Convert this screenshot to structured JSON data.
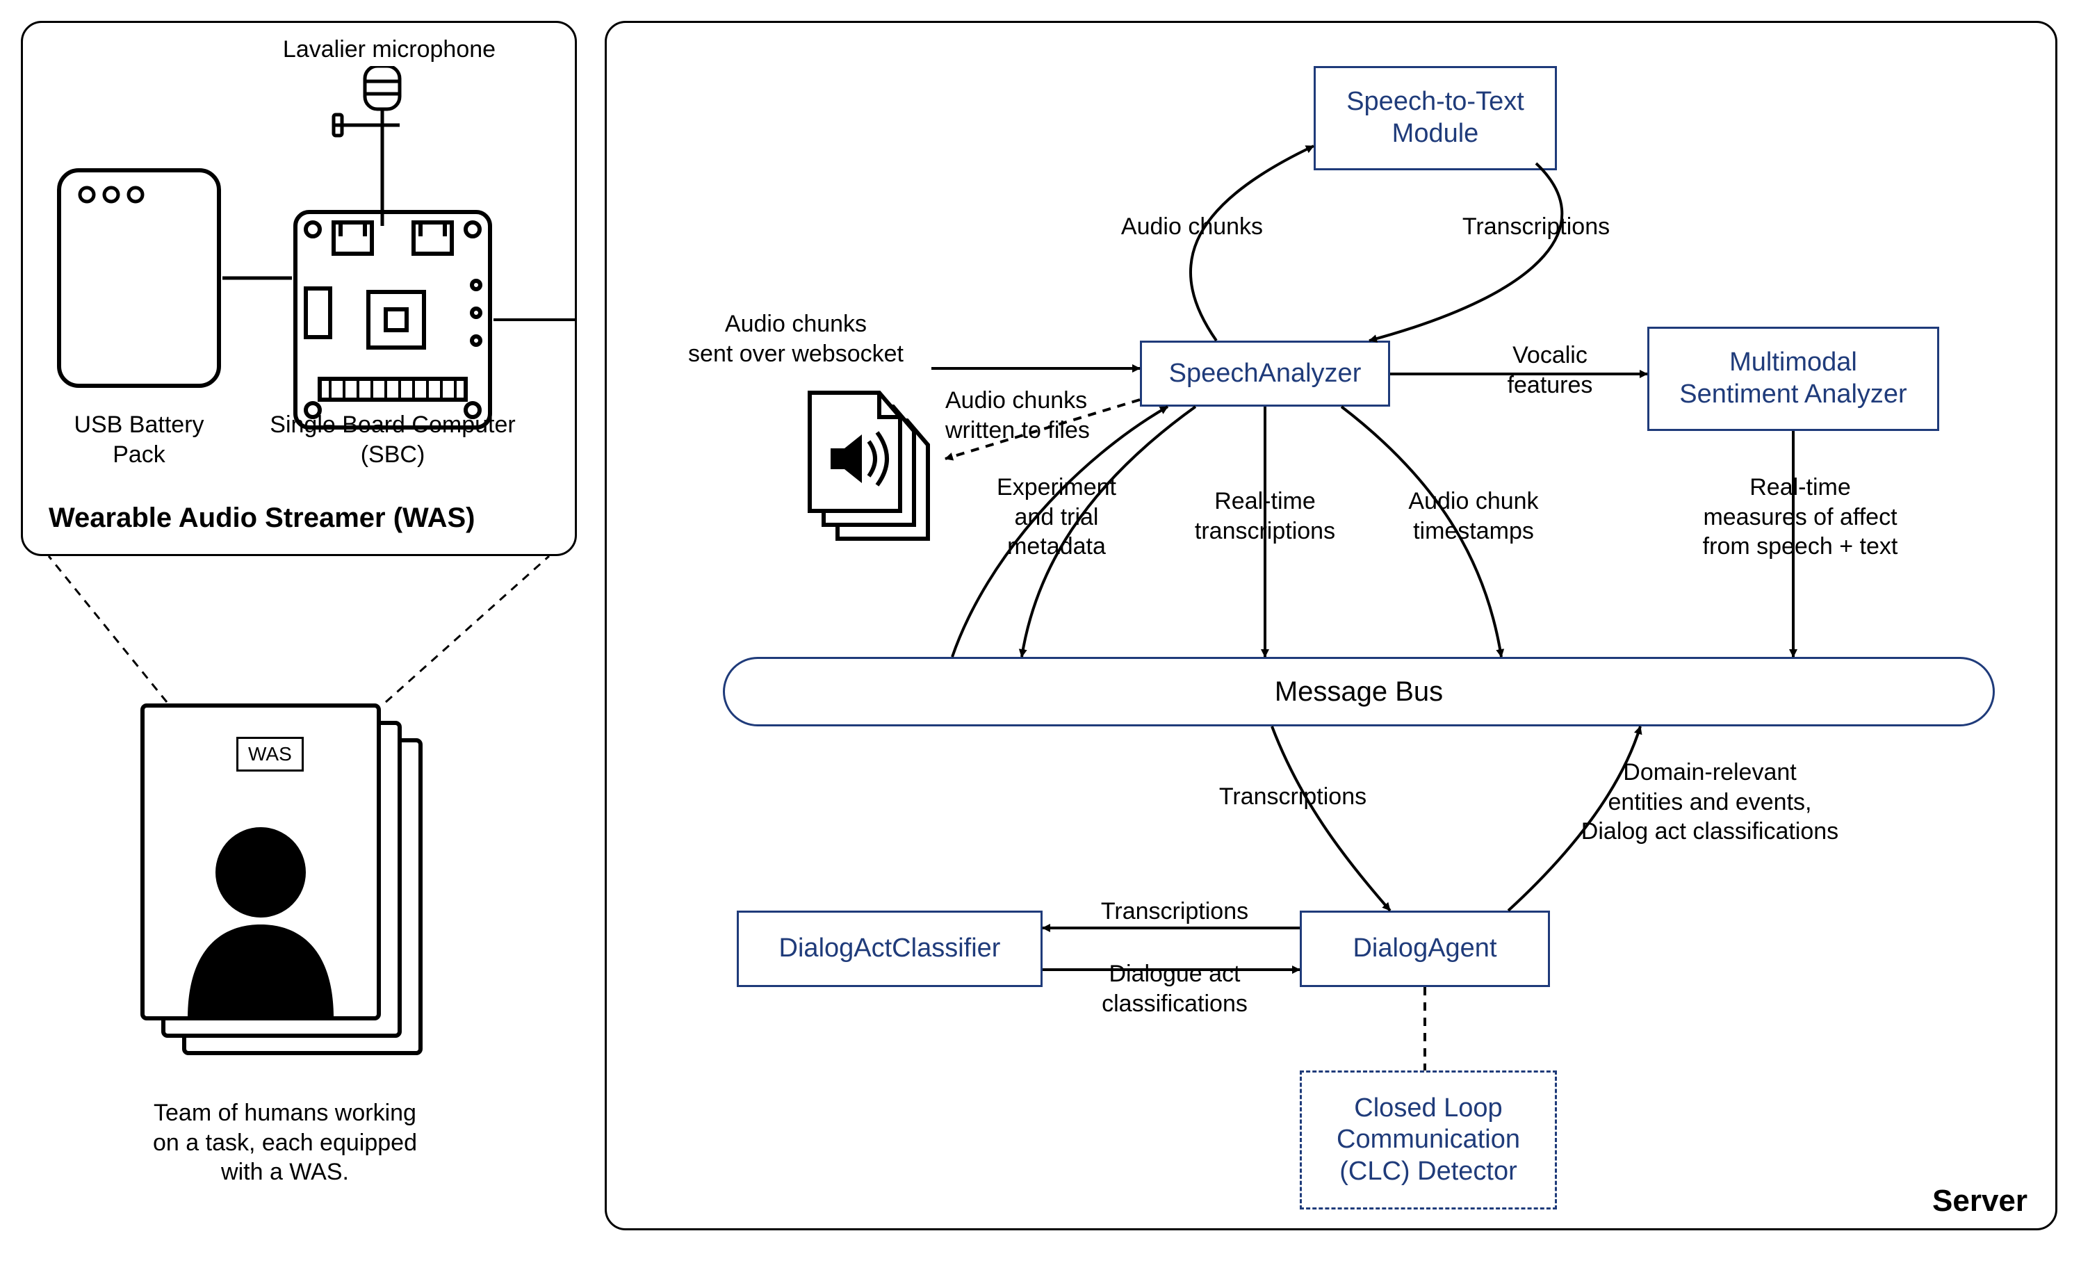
{
  "left": {
    "mic_label": "Lavalier microphone",
    "usb_label": "USB Battery Pack",
    "sbc_label": "Single Board Computer\n(SBC)",
    "panel_title": "Wearable Audio Streamer (WAS)",
    "was_tag": "WAS",
    "team_caption": "Team of humans working\non a task, each equipped\nwith a WAS."
  },
  "server": {
    "title": "Server",
    "speech_to_text": "Speech-to-Text\nModule",
    "speech_analyzer": "SpeechAnalyzer",
    "sentiment": "Multimodal\nSentiment Analyzer",
    "message_bus": "Message Bus",
    "dialog_act_classifier": "DialogActClassifier",
    "dialog_agent": "DialogAgent",
    "clc_detector": "Closed Loop\nCommunication\n(CLC) Detector"
  },
  "edges": {
    "audio_ws": "Audio chunks\nsent over websocket",
    "audio_files": "Audio chunks\nwritten to files",
    "audio_chunks_up": "Audio chunks",
    "transcriptions_down": "Transcriptions",
    "vocalic": "Vocalic\nfeatures",
    "rt_affect": "Real-time\nmeasures of affect\nfrom speech + text",
    "exp_meta": "Experiment\nand trial\nmetadata",
    "rt_trans": "Real-time\ntranscriptions",
    "chunk_ts": "Audio chunk\ntimestamps",
    "bus_trans": "Transcriptions",
    "domain_entities": "Domain-relevant\nentities and events,\nDialog act classifications",
    "dac_trans": "Transcriptions",
    "dac_cls": "Dialogue act\nclassifications"
  }
}
